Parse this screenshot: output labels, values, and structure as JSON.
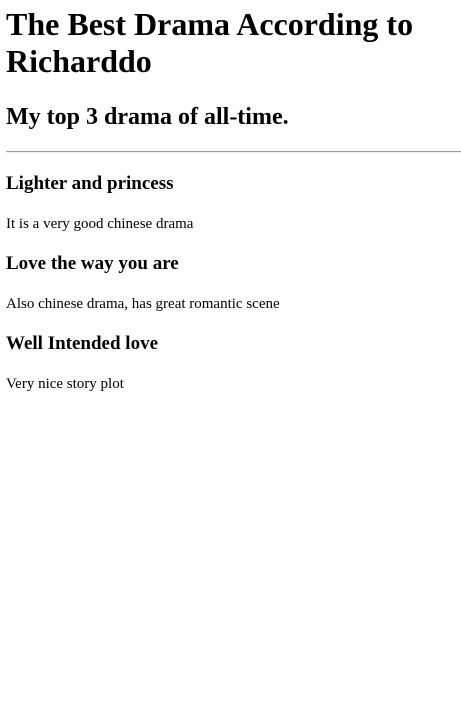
{
  "page": {
    "title": "The Best Drama According to Richarddo",
    "subtitle": "My top 3 drama of all-time."
  },
  "dramas": [
    {
      "name": "Lighter and princess",
      "description": "It is a very good chinese drama"
    },
    {
      "name": "Love the way you are",
      "description": "Also chinese drama, has great romantic scene"
    },
    {
      "name": "Well Intended love",
      "description": "Very nice story plot"
    }
  ]
}
